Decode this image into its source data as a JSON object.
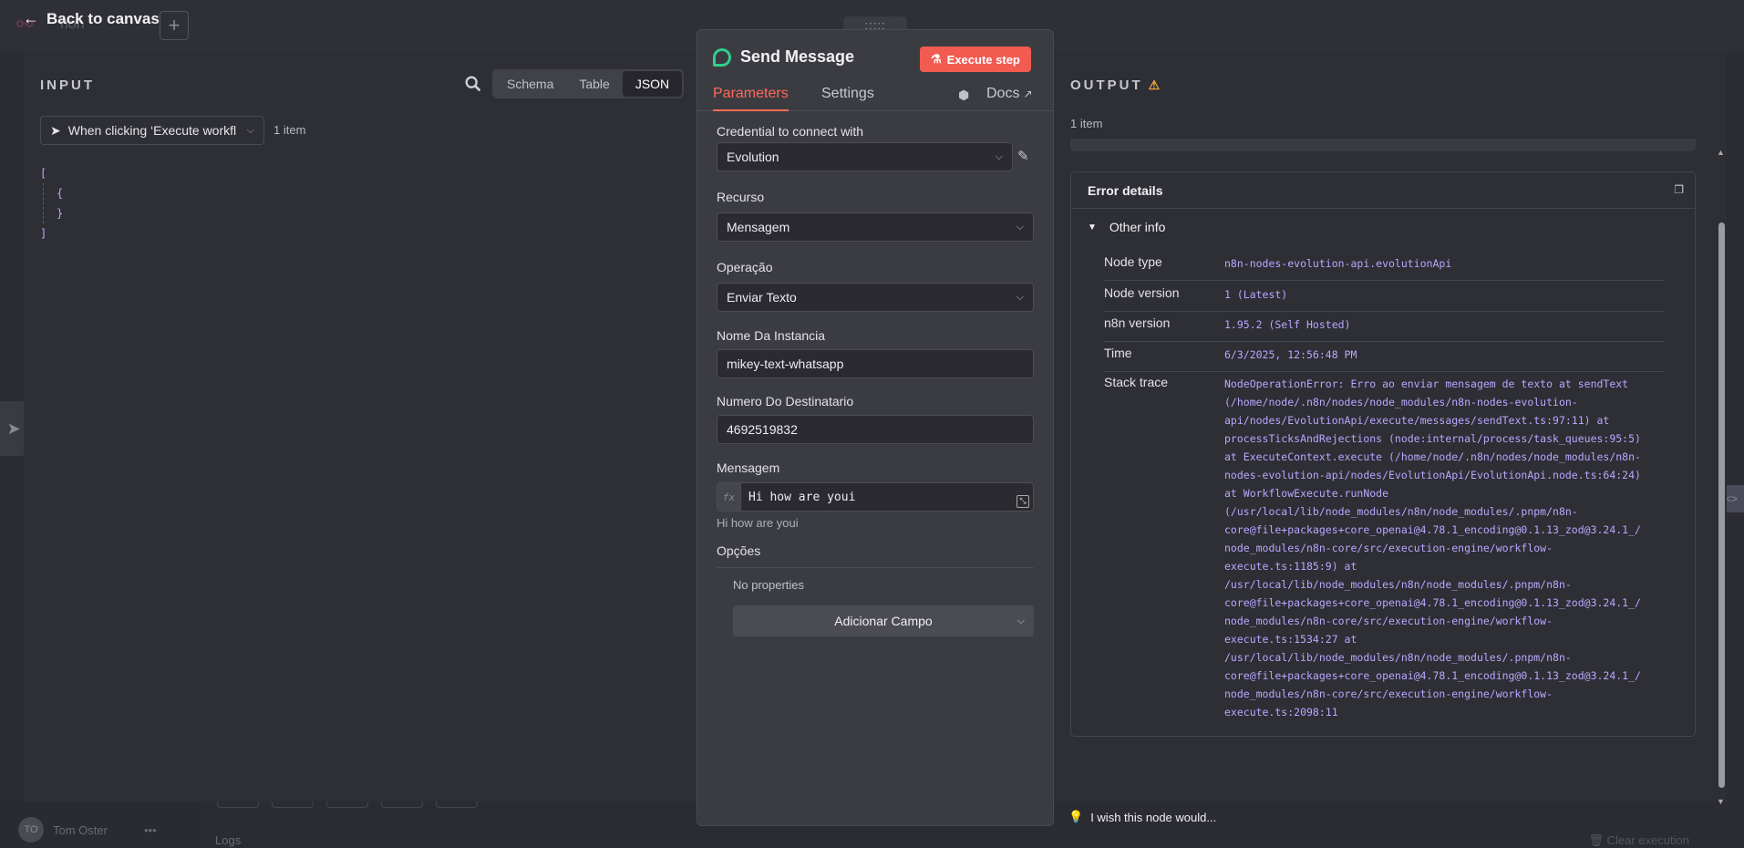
{
  "background": {
    "workflow_title": "non",
    "user_initials": "TO",
    "user_name": "Tom Oster",
    "logs_label": "Logs",
    "clear_execution": "Clear execution"
  },
  "nav": {
    "back_label": "Back to canvas",
    "add_label": "+"
  },
  "input": {
    "title": "INPUT",
    "view_modes": [
      "Schema",
      "Table",
      "JSON"
    ],
    "active_view": "JSON",
    "trigger_select": "When clicking ‘Execute workfl",
    "item_count": "1 item",
    "json_lines": [
      "[",
      "{",
      "}",
      "]"
    ]
  },
  "node": {
    "drag_handle": ":::::",
    "name": "Send Message",
    "execute_label": "Execute step",
    "tabs": {
      "parameters": "Parameters",
      "settings": "Settings",
      "docs": "Docs"
    },
    "fields": {
      "credential_label": "Credential to connect with",
      "credential_value": "Evolution",
      "recurso_label": "Recurso",
      "recurso_value": "Mensagem",
      "operacao_label": "Operação",
      "operacao_value": "Enviar Texto",
      "instancia_label": "Nome Da Instancia",
      "instancia_value": "mikey-text-whatsapp",
      "numero_label": "Numero Do Destinatario",
      "numero_value": "4692519832",
      "mensagem_label": "Mensagem",
      "mensagem_fx": "fx",
      "mensagem_value": "Hi how are youi",
      "mensagem_preview": "Hi how are youi",
      "opcoes_label": "Opções",
      "no_properties": "No properties",
      "add_field": "Adicionar Campo"
    }
  },
  "output": {
    "title": "OUTPUT",
    "item_count": "1 item",
    "error_details": "Error details",
    "other_info": "Other info",
    "rows": [
      {
        "key": "Node type",
        "value": "n8n-nodes-evolution-api.evolutionApi"
      },
      {
        "key": "Node version",
        "value": "1 (Latest)"
      },
      {
        "key": "n8n version",
        "value": "1.95.2 (Self Hosted)"
      },
      {
        "key": "Time",
        "value": "6/3/2025, 12:56:48 PM"
      }
    ],
    "stack_trace_label": "Stack trace",
    "stack_trace": "NodeOperationError: Erro ao enviar mensagem de texto at sendText\n(/home/node/.n8n/nodes/node_modules/n8n-nodes-evolution-\napi/nodes/EvolutionApi/execute/messages/sendText.ts:97:11) at\nprocessTicksAndRejections (node:internal/process/task_queues:95:5)\nat ExecuteContext.execute (/home/node/.n8n/nodes/node_modules/n8n-\nnodes-evolution-api/nodes/EvolutionApi/EvolutionApi.node.ts:64:24)\nat WorkflowExecute.runNode\n(/usr/local/lib/node_modules/n8n/node_modules/.pnpm/n8n-\ncore@file+packages+core_openai@4.78.1_encoding@0.1.13_zod@3.24.1_/\nnode_modules/n8n-core/src/execution-engine/workflow-\nexecute.ts:1185:9) at\n/usr/local/lib/node_modules/n8n/node_modules/.pnpm/n8n-\ncore@file+packages+core_openai@4.78.1_encoding@0.1.13_zod@3.24.1_/\nnode_modules/n8n-core/src/execution-engine/workflow-\nexecute.ts:1534:27 at\n/usr/local/lib/node_modules/n8n/node_modules/.pnpm/n8n-\ncore@file+packages+core_openai@4.78.1_encoding@0.1.13_zod@3.24.1_/\nnode_modules/n8n-core/src/execution-engine/workflow-\nexecute.ts:2098:11",
    "feedback": "I wish this node would..."
  },
  "colors": {
    "accent": "#ff6b5a",
    "execute_button": "#f15b50",
    "json_text": "#b9a8ff",
    "warning": "#f0a83c",
    "node_icon": "#2fcf8f"
  },
  "icons": {
    "back": "arrow-left-icon",
    "search": "search-icon",
    "cursor": "pointer-icon",
    "flask": "flask-icon",
    "pencil": "pencil-icon",
    "box": "package-icon",
    "external": "external-link-icon",
    "copy": "copy-icon",
    "warning": "warning-triangle-icon",
    "bulb": "lightbulb-icon"
  }
}
